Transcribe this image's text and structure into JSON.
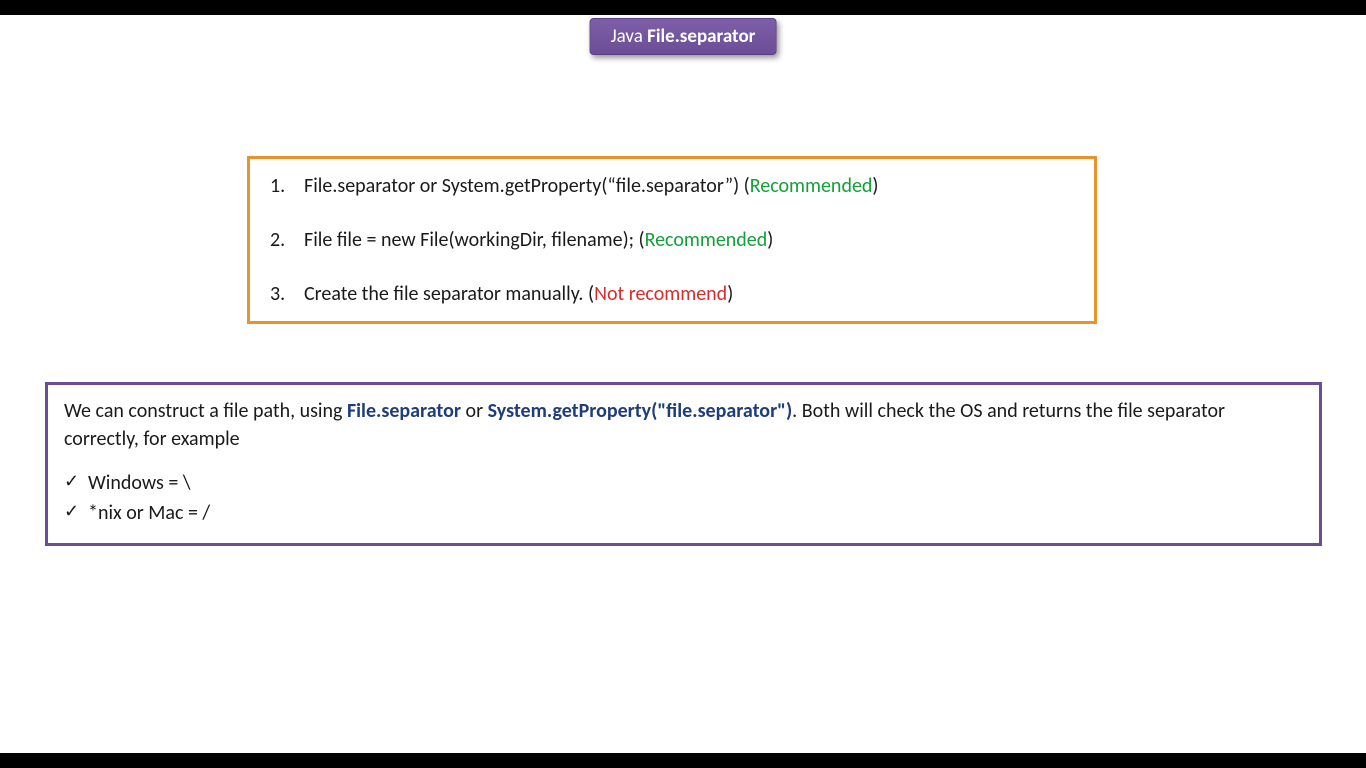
{
  "title": {
    "prefix": "Java ",
    "main": "File.separator"
  },
  "methods": {
    "item1": {
      "text": "File.separator or System.getProperty(“file.separator”) (",
      "tag": "Recommended",
      "suffix": ")"
    },
    "item2": {
      "text": "File file = new File(workingDir, filename); (",
      "tag": "Recommended",
      "suffix": ")"
    },
    "item3": {
      "text": "Create the file separator manually. (",
      "tag": "Not recommend",
      "suffix": ")"
    }
  },
  "explanation": {
    "part1": "We can construct a file path, using ",
    "code1": "File.separator",
    "part2": " or ",
    "code2": "System.getProperty(\"file.separator\")",
    "part3": ". Both will check the OS and returns the file separator correctly, for example"
  },
  "examples": {
    "windows": "Windows = \\",
    "nix": "*nix or Mac = /"
  }
}
